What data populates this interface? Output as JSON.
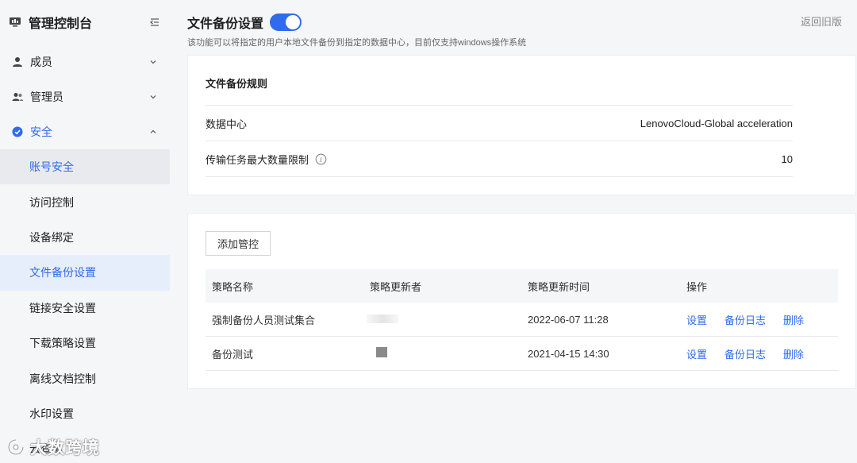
{
  "sidebar": {
    "title": "管理控制台",
    "groups": [
      {
        "label": "成员",
        "icon": "user-icon"
      },
      {
        "label": "管理员",
        "icon": "users-icon"
      },
      {
        "label": "安全",
        "icon": "shield-check-icon"
      }
    ],
    "items": [
      {
        "label": "账号安全"
      },
      {
        "label": "访问控制"
      },
      {
        "label": "设备绑定"
      },
      {
        "label": "文件备份设置"
      },
      {
        "label": "链接安全设置"
      },
      {
        "label": "下载策略设置"
      },
      {
        "label": "离线文档控制"
      },
      {
        "label": "水印设置"
      },
      {
        "label": "云查毒"
      }
    ]
  },
  "header": {
    "title": "文件备份设置",
    "toggle_on": true,
    "description": "该功能可以将指定的用户本地文件备份到指定的数据中心，目前仅支持windows操作系统",
    "back_label": "返回旧版"
  },
  "rules": {
    "title": "文件备份规则",
    "rows": [
      {
        "label": "数据中心",
        "value": "LenovoCloud-Global acceleration"
      },
      {
        "label": "传输任务最大数量限制",
        "value": "10"
      }
    ]
  },
  "policies": {
    "add_button": "添加管控",
    "columns": [
      "策略名称",
      "策略更新者",
      "策略更新时间",
      "操作"
    ],
    "rows": [
      {
        "name": "强制备份人员测试集合",
        "updated_at": "2022-06-07 11:28"
      },
      {
        "name": "备份测试",
        "updated_at": "2021-04-15 14:30"
      }
    ],
    "actions": [
      "设置",
      "备份日志",
      "删除"
    ]
  },
  "watermark": {
    "text": "大数跨境"
  },
  "colors": {
    "accent": "#2f6bed",
    "background": "#f5f6f8",
    "selected_bg": "#e7eefb"
  }
}
